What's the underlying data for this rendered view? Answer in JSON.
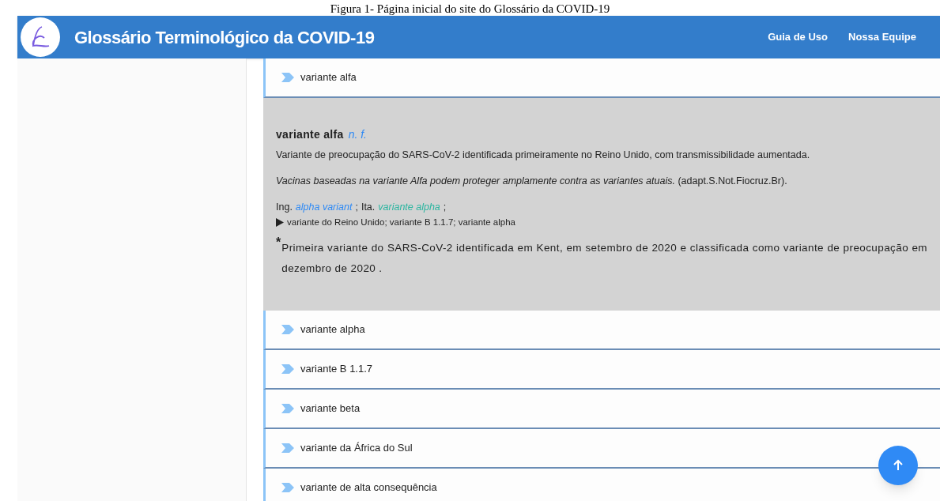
{
  "caption": "Figura 1- Página inicial do site do Glossário da COVID-19",
  "header": {
    "title": "Glossário Terminológico da COVID-19",
    "nav": [
      "Guia de Uso",
      "Nossa Equipe"
    ]
  },
  "entries": [
    {
      "term": "variante alfa",
      "definition": {
        "headword": "variante alfa",
        "grammar": "n. f.",
        "text": "Variante de preocupação do SARS-CoV-2 identificada primeiramente no Reino Unido, com transmissibilidade aumentada.",
        "example": "Vacinas baseadas na variante Alfa podem proteger amplamente contra as variantes atuais.",
        "source": "(adapt.S.Not.Fiocruz.Br).",
        "equivalents": [
          {
            "lang": "Ing.",
            "term": "alpha variant",
            "color": "#2f8af5",
            "separator": ";"
          },
          {
            "lang": "Ita.",
            "term": "variante alpha",
            "color": "#2bb5a0",
            "separator": ";"
          }
        ],
        "synonyms": "variante do Reino Unido; variante B 1.1.7; variante alpha",
        "note_mark": "*",
        "note": "Primeira variante do SARS-CoV-2 identificada em Kent, em setembro de 2020 e classificada como variante de preocupação em dezembro de 2020 ."
      }
    },
    {
      "term": "variante alpha"
    },
    {
      "term": "variante B 1.1.7"
    },
    {
      "term": "variante beta"
    },
    {
      "term": "variante da África do Sul"
    },
    {
      "term": "variante de alta consequência"
    }
  ]
}
